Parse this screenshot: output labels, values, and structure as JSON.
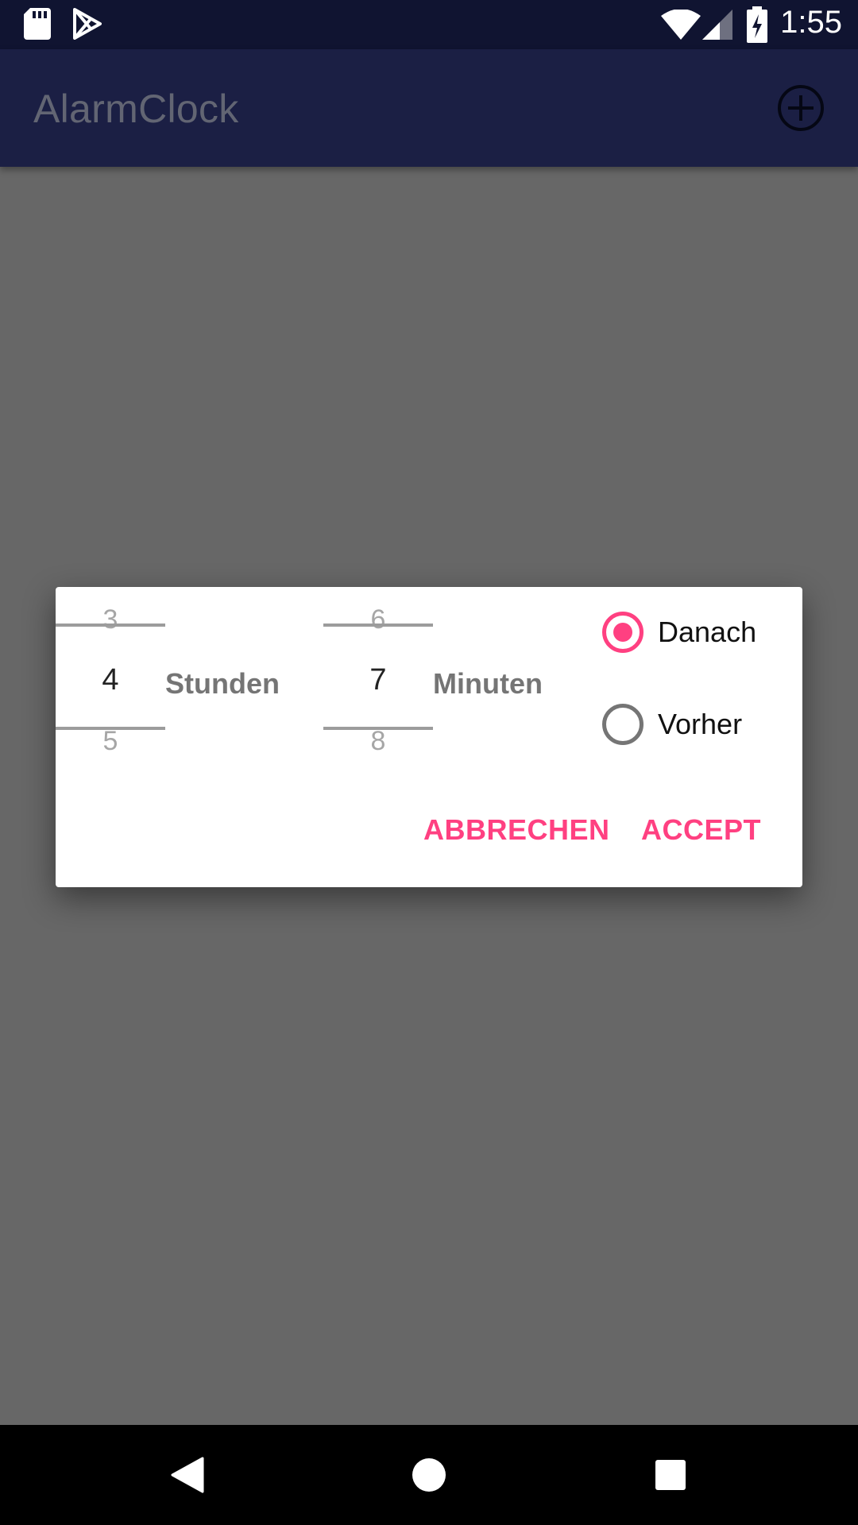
{
  "status_bar": {
    "time": "1:55",
    "icons": [
      "sd-card-icon",
      "play-store-icon",
      "wifi-icon",
      "signal-icon",
      "battery-charging-icon"
    ]
  },
  "app_bar": {
    "title": "AlarmClock",
    "action_icon": "add-circle-icon"
  },
  "dialog": {
    "hours_picker": {
      "prev": "3",
      "selected": "4",
      "next": "5"
    },
    "hours_label": "Stunden",
    "minutes_picker": {
      "prev": "6",
      "selected": "7",
      "next": "8"
    },
    "minutes_label": "Minuten",
    "radio_options": [
      {
        "label": "Danach",
        "checked": true
      },
      {
        "label": "Vorher",
        "checked": false
      }
    ],
    "cancel_label": "ABBRECHEN",
    "accept_label": "ACCEPT"
  },
  "colors": {
    "accent": "#ff4081",
    "status_bar": "#101431",
    "app_bar": "#1b1f44",
    "scrim": "#676767"
  },
  "nav_bar": {
    "icons": [
      "back-icon",
      "home-icon",
      "recents-icon"
    ]
  }
}
